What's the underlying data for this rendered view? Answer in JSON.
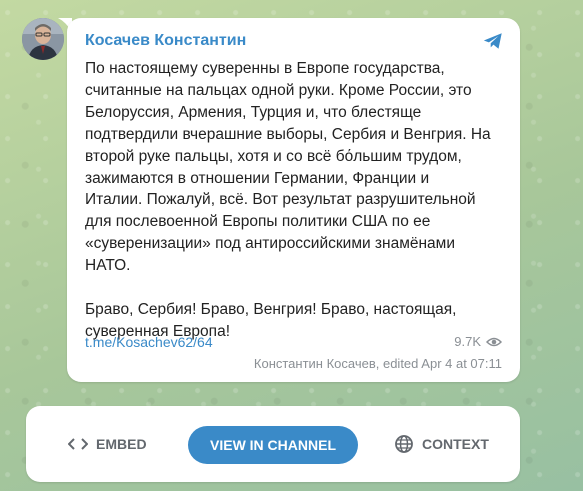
{
  "post": {
    "channel_name": "Косачев Константин",
    "text": "По настоящему суверенны в Европе государства,\nсчитанные на пальцах одной руки. Кроме России, это\nБелоруссия, Армения, Турция и, что блестяще\nподтвердили вчерашние выборы, Сербия и Венгрия. На\nвторой руке пальцы, хотя и со всё бόльшим трудом,\nзажимаются в отношении Германии, Франции и\nИталии. Пожалуй, всё. Вот результат разрушительной\nдля послевоенной Европы политики США по ее\n«суверенизации» под антироссийскими знамёнами\nНАТО.\n\nБраво, Сербия! Браво, Венгрия! Браво, настоящая,\nсуверенная Европа!",
    "link": "t.me/Kosachev62/64",
    "views": "9.7K",
    "author_meta": "Константин Косачев, edited  Apr 4 at 07:11"
  },
  "actions": {
    "embed": "EMBED",
    "view_in_channel": "VIEW IN CHANNEL",
    "context": "CONTEXT"
  },
  "icons": {
    "telegram": "telegram-plane-icon",
    "views": "eye-icon",
    "embed": "code-brackets-icon",
    "context": "globe-icon"
  },
  "colors": {
    "accent": "#3a8ac8",
    "muted": "#8a8f94",
    "button_text": "#63686e"
  }
}
